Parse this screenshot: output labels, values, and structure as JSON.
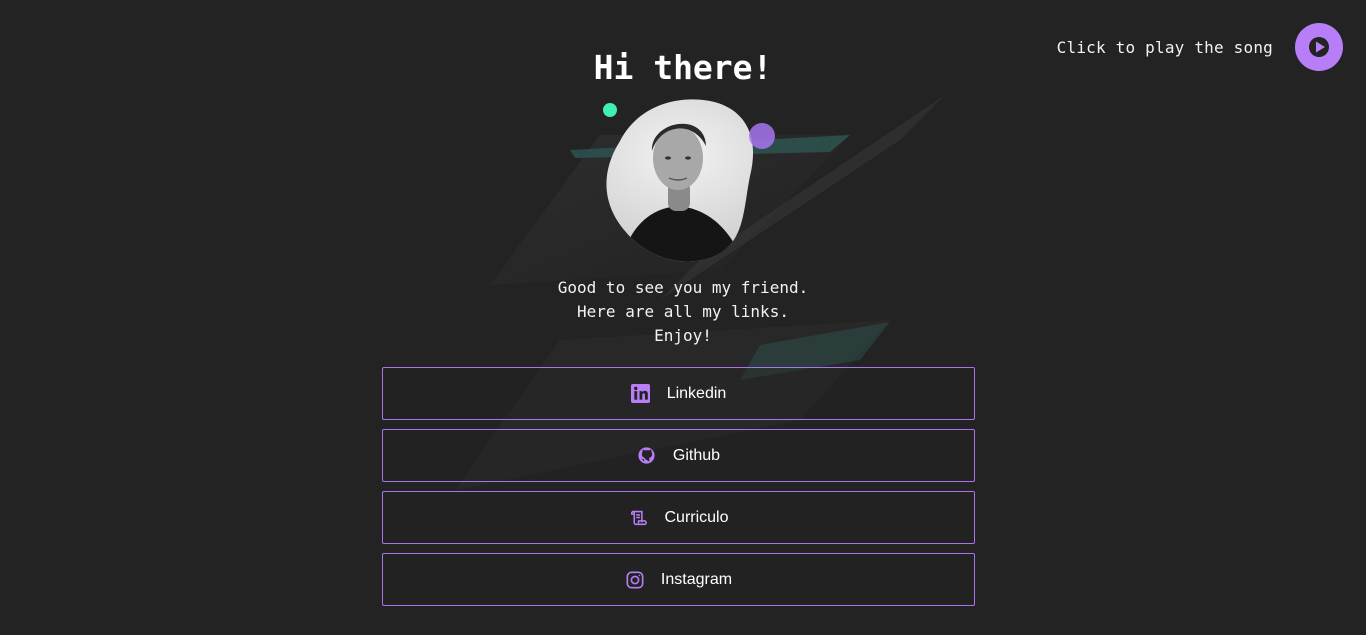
{
  "player": {
    "label": "Click to play the song",
    "icon": "play-icon"
  },
  "hero": {
    "title": "Hi there!",
    "greeting_lines": [
      "Good to see you my friend.",
      "Here are all my links.",
      "Enjoy!"
    ]
  },
  "links": [
    {
      "label": "Linkedin",
      "icon": "linkedin-icon"
    },
    {
      "label": "Github",
      "icon": "github-icon"
    },
    {
      "label": "Curriculo",
      "icon": "scroll-icon"
    },
    {
      "label": "Instagram",
      "icon": "instagram-icon"
    }
  ],
  "colors": {
    "background": "#232323",
    "accent": "#b87ef7",
    "border": "#a874f0",
    "teal": "#3ff0b0"
  }
}
